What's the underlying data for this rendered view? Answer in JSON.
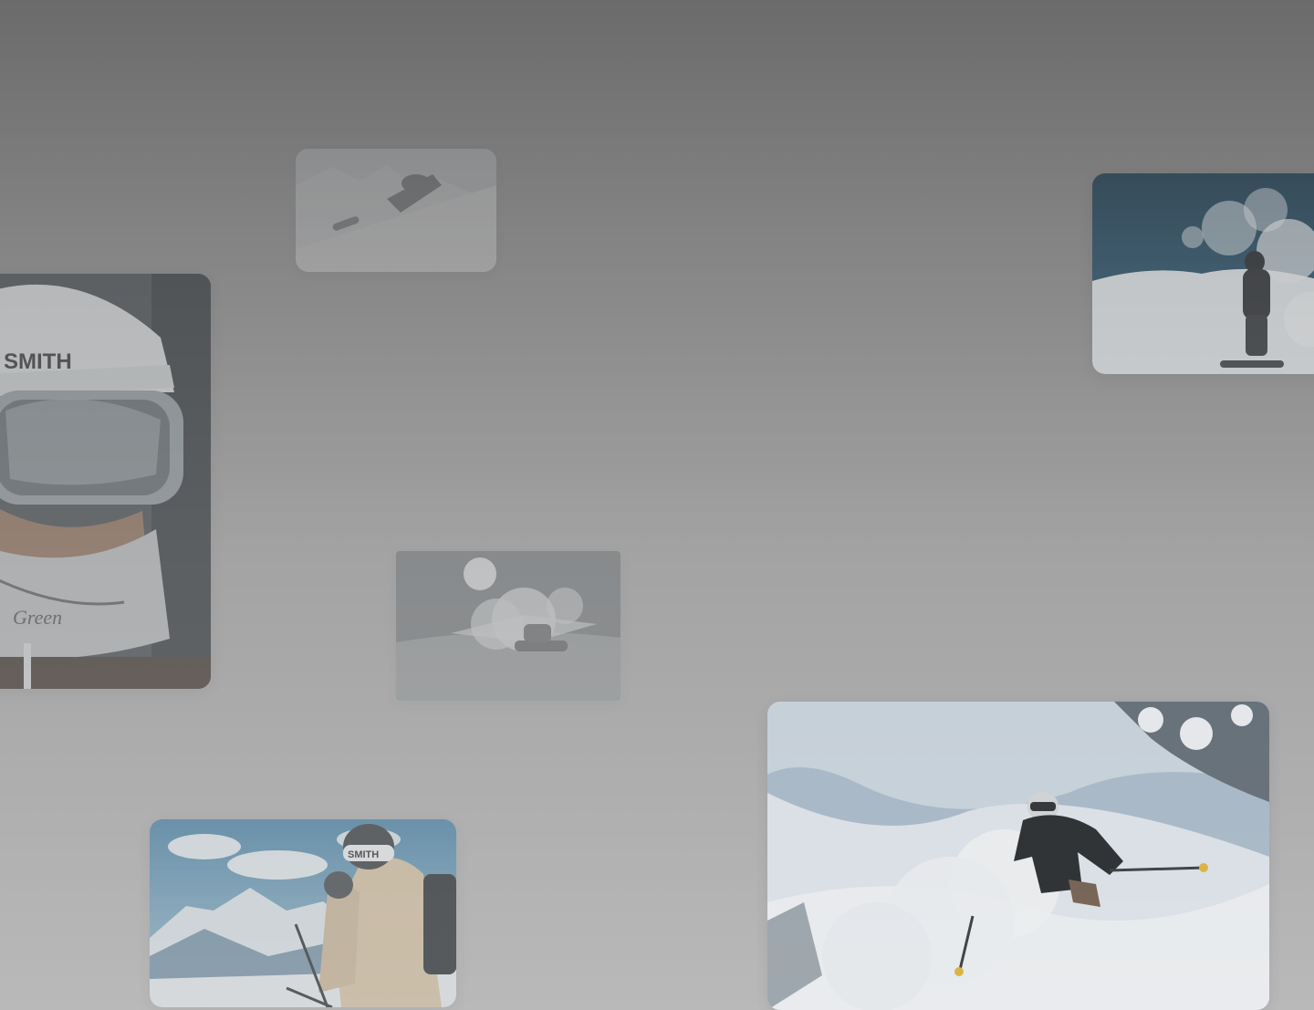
{
  "photos": [
    {
      "id": "snowboard-carve",
      "description": "snowboarder carving on slope"
    },
    {
      "id": "powder-spray",
      "description": "snowboarder in powder spray against blue sky"
    },
    {
      "id": "goggle-portrait",
      "description": "skier portrait with helmet and goggles"
    },
    {
      "id": "spin-burst",
      "description": "snowboarder spinning with snow burst"
    },
    {
      "id": "two-skiers",
      "description": "two skiers looking at mountains"
    },
    {
      "id": "deep-powder",
      "description": "skier in deep powder with poles"
    }
  ],
  "logos": {
    "helmet_brand": "SMITH",
    "goggle_brand": "SMITH",
    "neck_gaiter": "Green"
  },
  "colors": {
    "backdrop_top": "#6b6b6b",
    "backdrop_bottom": "#b9b9b9",
    "sky_blue": "#0e3a55",
    "snow": "#e8edf2",
    "jacket_beige": "#d8c3a3",
    "pole_yellow": "#e4b52a"
  }
}
